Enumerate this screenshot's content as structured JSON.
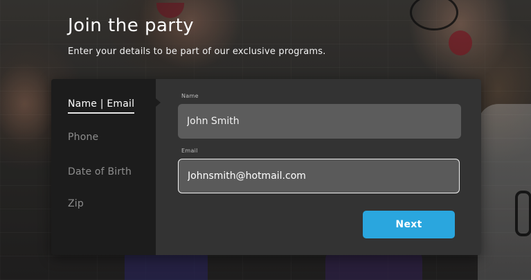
{
  "page": {
    "title": "Join the party",
    "subtitle": "Enter your details to be part of our exclusive programs."
  },
  "steps": {
    "items": [
      {
        "label": "Name | Email",
        "active": true
      },
      {
        "label": "Phone",
        "active": false
      },
      {
        "label": "Date of Birth",
        "active": false
      },
      {
        "label": "Zip",
        "active": false
      }
    ]
  },
  "form": {
    "name_label": "Name",
    "name_value": "John Smith",
    "email_label": "Email",
    "email_value": "Johnsmith@hotmail.com",
    "next_label": "Next"
  },
  "colors": {
    "accent": "#2aa6de",
    "card_panel": "#333333",
    "steps_panel": "#1c1c1c",
    "input_fill": "#5c5c5c"
  }
}
